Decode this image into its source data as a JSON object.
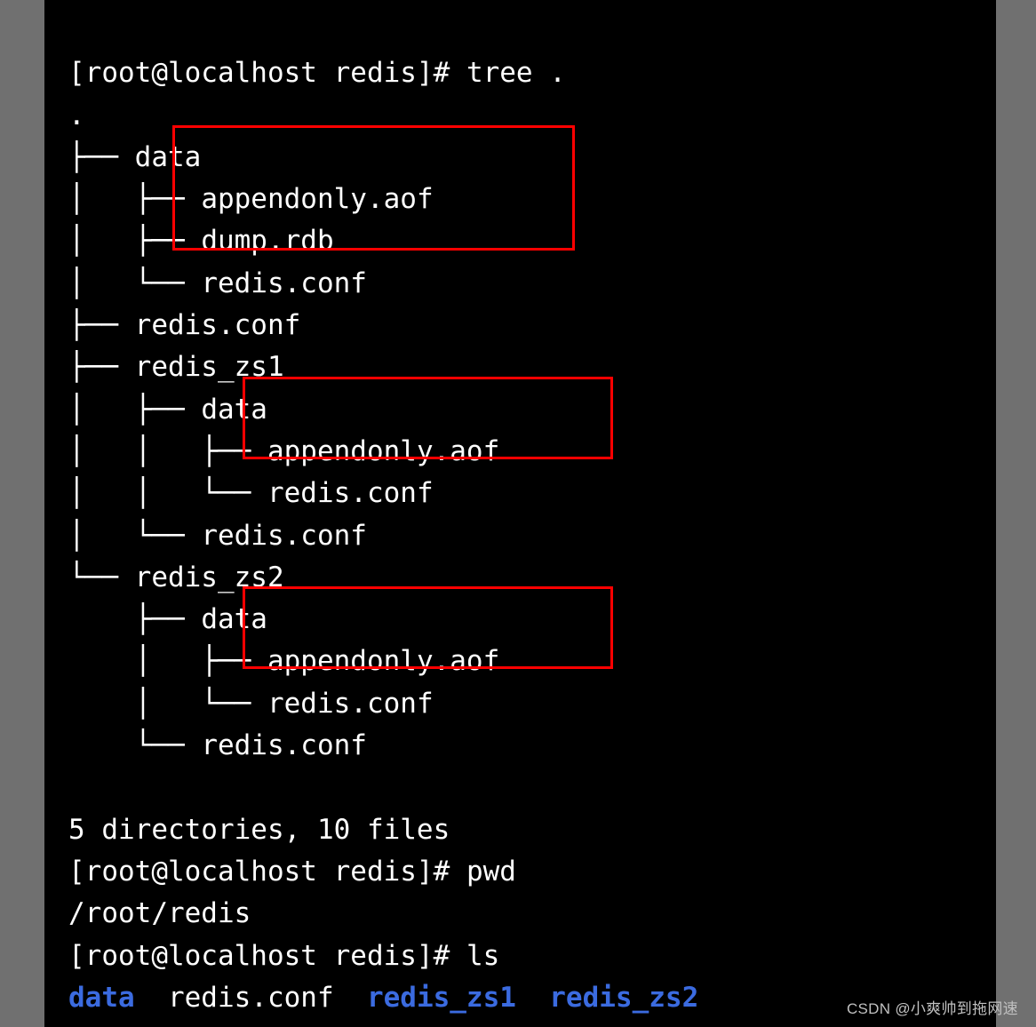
{
  "prompt": "[root@localhost redis]#",
  "commands": {
    "tree": "tree .",
    "pwd": "pwd",
    "ls": "ls"
  },
  "tree": {
    "root": ".",
    "items": {
      "data": "data",
      "data_appendonly": "appendonly.aof",
      "data_dump": "dump.rdb",
      "data_conf": "redis.conf",
      "root_conf": "redis.conf",
      "zs1": "redis_zs1",
      "zs1_data": "data",
      "zs1_appendonly": "appendonly.aof",
      "zs1_data_conf": "redis.conf",
      "zs1_conf": "redis.conf",
      "zs2": "redis_zs2",
      "zs2_data": "data",
      "zs2_appendonly": "appendonly.aof",
      "zs2_data_conf": "redis.conf",
      "zs2_conf": "redis.conf"
    },
    "summary": "5 directories, 10 files"
  },
  "pwd_out": "/root/redis",
  "ls_out": {
    "data": "data",
    "conf": "redis.conf",
    "zs1": "redis_zs1",
    "zs2": "redis_zs2"
  },
  "footer": "CSDN @小爽帅到拖网速"
}
